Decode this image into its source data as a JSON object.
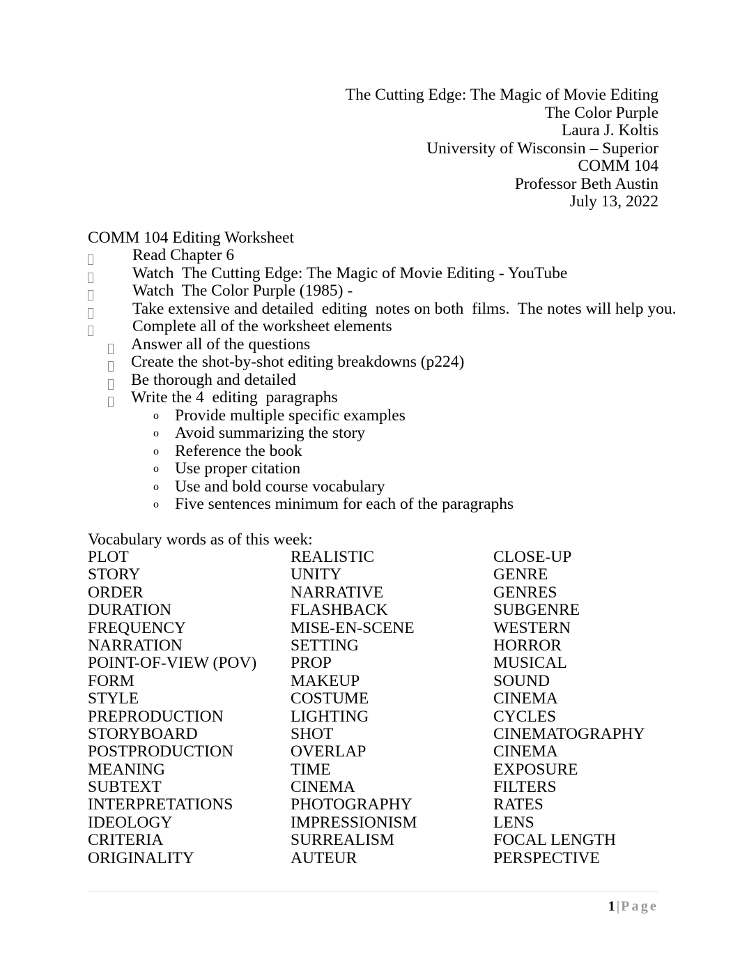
{
  "document": {
    "title": "COMM 104 Editing Worksheet",
    "header": {
      "lines": [
        "The Cutting Edge: The Magic of Movie Editing",
        "The Color Purple",
        "Laura J. Koltis",
        "University of Wisconsin – Superior",
        "COMM 104",
        "Professor Beth Austin",
        "July 13, 2022"
      ]
    },
    "body_heading": "COMM 104 Editing Worksheet",
    "tasks": [
      {
        "level": 1,
        "marker": "tofu-box",
        "text": "Read Chapter 6"
      },
      {
        "level": 1,
        "marker": "tofu-box",
        "text": "Watch  The Cutting Edge: The Magic of Movie Editing - YouTube"
      },
      {
        "level": 1,
        "marker": "tofu-box",
        "text": "Watch  The Color Purple (1985) -"
      },
      {
        "level": 1,
        "marker": "tofu-box",
        "text": "Take extensive and detailed  editing  notes on both  films.  The notes will help you."
      },
      {
        "level": 1,
        "marker": "tofu-box",
        "text": "Complete all of the worksheet elements"
      },
      {
        "level": 2,
        "marker": "tofu-box",
        "text": "Answer all of the questions"
      },
      {
        "level": 2,
        "marker": "tofu-box",
        "text": "Create the shot-by-shot editing breakdowns (p224)"
      },
      {
        "level": 2,
        "marker": "tofu-box",
        "text": "Be thorough and detailed"
      },
      {
        "level": 2,
        "marker": "tofu-box",
        "text": "Write the 4  editing  paragraphs"
      },
      {
        "level": 3,
        "marker": "o",
        "text": "Provide multiple specific examples"
      },
      {
        "level": 3,
        "marker": "o",
        "text": "Avoid summarizing the story"
      },
      {
        "level": 3,
        "marker": "o",
        "text": "Reference the book"
      },
      {
        "level": 3,
        "marker": "o",
        "text": "Use proper citation"
      },
      {
        "level": 3,
        "marker": "o",
        "text": "Use and bold course vocabulary"
      },
      {
        "level": 3,
        "marker": "o",
        "text": "Five sentences minimum for each of the paragraphs"
      }
    ],
    "vocabulary": {
      "intro": "Vocabulary words as of this week:",
      "rows": [
        [
          "PLOT",
          "REALISTIC",
          "CLOSE-UP"
        ],
        [
          "STORY",
          "UNITY",
          "GENRE"
        ],
        [
          "ORDER",
          "NARRATIVE",
          "GENRES"
        ],
        [
          "DURATION",
          "FLASHBACK",
          "SUBGENRE"
        ],
        [
          "FREQUENCY",
          "MISE-EN-SCENE",
          "WESTERN"
        ],
        [
          "NARRATION",
          "SETTING",
          "HORROR"
        ],
        [
          "POINT-OF-VIEW (POV)",
          "PROP",
          "MUSICAL"
        ],
        [
          "FORM",
          "MAKEUP",
          "SOUND"
        ],
        [
          "STYLE",
          "COSTUME",
          "CINEMA"
        ],
        [
          "PREPRODUCTION",
          "LIGHTING",
          "CYCLES"
        ],
        [
          "STORYBOARD",
          "SHOT",
          "CINEMATOGRAPHY"
        ],
        [
          "POSTPRODUCTION",
          "OVERLAP",
          "CINEMA"
        ],
        [
          "MEANING",
          "TIME",
          "EXPOSURE"
        ],
        [
          "SUBTEXT",
          "CINEMA",
          "FILTERS"
        ],
        [
          "INTERPRETATIONS",
          "PHOTOGRAPHY",
          "RATES"
        ],
        [
          "IDEOLOGY",
          "IMPRESSIONISM",
          "LENS"
        ],
        [
          "CRITERIA",
          "SURREALISM",
          "FOCAL LENGTH"
        ],
        [
          "ORIGINALITY",
          "AUTEUR",
          "PERSPECTIVE"
        ]
      ]
    },
    "footer": {
      "page_number": "1",
      "separator": "|",
      "page_word": "Page"
    },
    "colors": {
      "text": "#000000",
      "footer_gray": "#9a9a9a",
      "rule_gray": "#e8e8e8",
      "bullet_gray": "#8a8a8a"
    }
  }
}
